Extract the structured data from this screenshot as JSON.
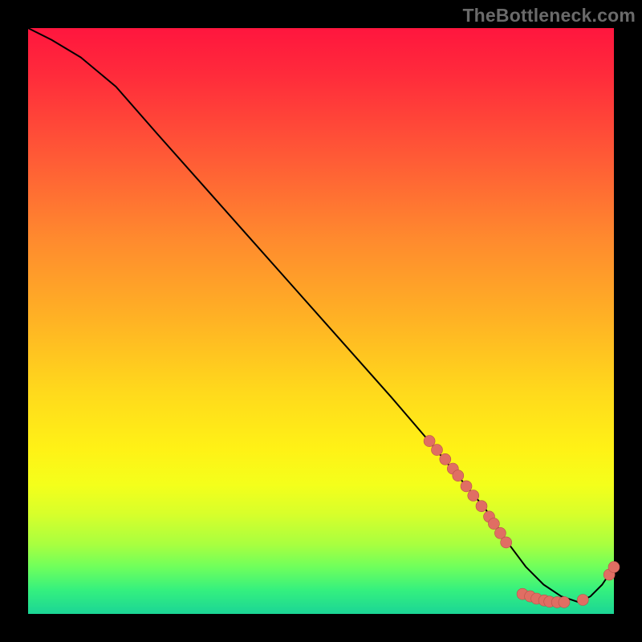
{
  "watermark": "TheBottleneck.com",
  "colors": {
    "dot_fill": "#e06e63",
    "dot_stroke": "#b85149",
    "line": "#000000"
  },
  "chart_data": {
    "type": "line",
    "title": "",
    "xlabel": "",
    "ylabel": "",
    "xlim": [
      0,
      100
    ],
    "ylim": [
      0,
      100
    ],
    "grid": false,
    "legend": false,
    "series": [
      {
        "name": "curve",
        "x": [
          0,
          4,
          9,
          15,
          22,
          30,
          38,
          46,
          54,
          62,
          68,
          73,
          78,
          82,
          85,
          88,
          91,
          94,
          96,
          98,
          100
        ],
        "y": [
          100,
          98,
          95,
          90,
          82,
          73,
          64,
          55,
          46,
          37,
          30,
          24,
          18,
          12,
          8,
          5,
          3,
          2,
          3,
          5,
          8
        ]
      }
    ],
    "points": [
      {
        "x": 68.5,
        "y": 29.5
      },
      {
        "x": 69.8,
        "y": 28.0
      },
      {
        "x": 71.2,
        "y": 26.4
      },
      {
        "x": 72.5,
        "y": 24.8
      },
      {
        "x": 73.4,
        "y": 23.6
      },
      {
        "x": 74.8,
        "y": 21.8
      },
      {
        "x": 76.0,
        "y": 20.2
      },
      {
        "x": 77.4,
        "y": 18.4
      },
      {
        "x": 78.7,
        "y": 16.6
      },
      {
        "x": 79.5,
        "y": 15.4
      },
      {
        "x": 80.6,
        "y": 13.8
      },
      {
        "x": 81.6,
        "y": 12.2
      },
      {
        "x": 84.4,
        "y": 3.4
      },
      {
        "x": 85.7,
        "y": 3.0
      },
      {
        "x": 86.8,
        "y": 2.6
      },
      {
        "x": 88.1,
        "y": 2.3
      },
      {
        "x": 89.0,
        "y": 2.1
      },
      {
        "x": 90.3,
        "y": 2.0
      },
      {
        "x": 91.5,
        "y": 2.0
      },
      {
        "x": 94.7,
        "y": 2.4
      },
      {
        "x": 99.2,
        "y": 6.7
      },
      {
        "x": 100.0,
        "y": 8.0
      }
    ],
    "dot_radius": 7
  }
}
